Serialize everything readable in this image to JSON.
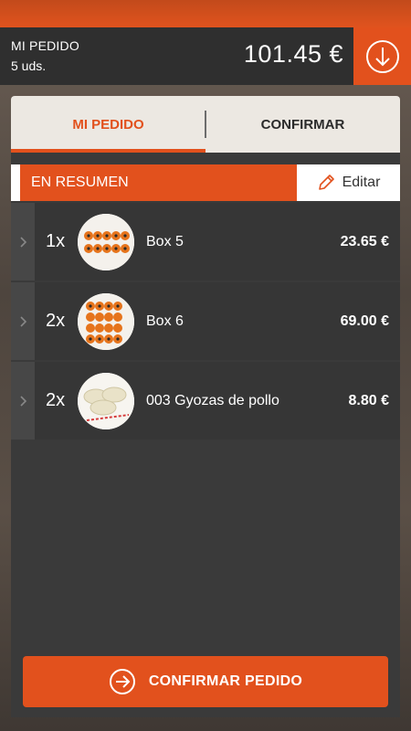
{
  "header": {
    "title": "MI PEDIDO",
    "units": "5 uds.",
    "total": "101.45 €",
    "download_icon": "arrow-down-circle-icon"
  },
  "tabs": [
    {
      "label": "MI PEDIDO",
      "active": true
    },
    {
      "label": "CONFIRMAR",
      "active": false
    }
  ],
  "summary": {
    "label": "EN RESUMEN",
    "edit_label": "Editar",
    "edit_icon": "pencil-icon"
  },
  "items": [
    {
      "qty": "1x",
      "name": "Box 5",
      "price": "23.65 €",
      "image": "sushi-box-image"
    },
    {
      "qty": "2x",
      "name": "Box 6",
      "price": "69.00 €",
      "image": "sushi-box-image"
    },
    {
      "qty": "2x",
      "name": "003 Gyozas de pollo",
      "price": "8.80 €",
      "image": "gyoza-image"
    }
  ],
  "confirm_button": {
    "label": "CONFIRMAR PEDIDO",
    "icon": "arrow-right-circle-icon"
  },
  "colors": {
    "accent": "#e2511d",
    "dark": "#2f2f2f",
    "panel": "#3a3a3a",
    "tab_bg": "#ece8e2"
  }
}
